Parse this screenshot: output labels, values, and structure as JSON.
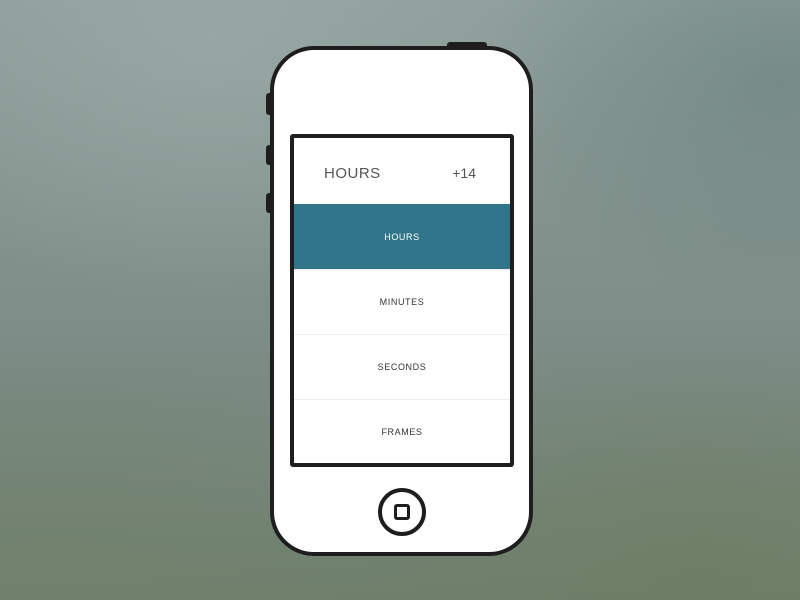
{
  "screen": {
    "header": {
      "title": "HOURS",
      "value": "+14"
    },
    "options": [
      {
        "label": "HOURS",
        "selected": true
      },
      {
        "label": "MINUTES",
        "selected": false
      },
      {
        "label": "SECONDS",
        "selected": false
      },
      {
        "label": "FRAMES",
        "selected": false
      }
    ]
  },
  "colors": {
    "accent": "#31758a",
    "device_outline": "#1e1e1e",
    "screen_background": "#ffffff"
  },
  "icons": {
    "home_button": "home-button-icon"
  }
}
